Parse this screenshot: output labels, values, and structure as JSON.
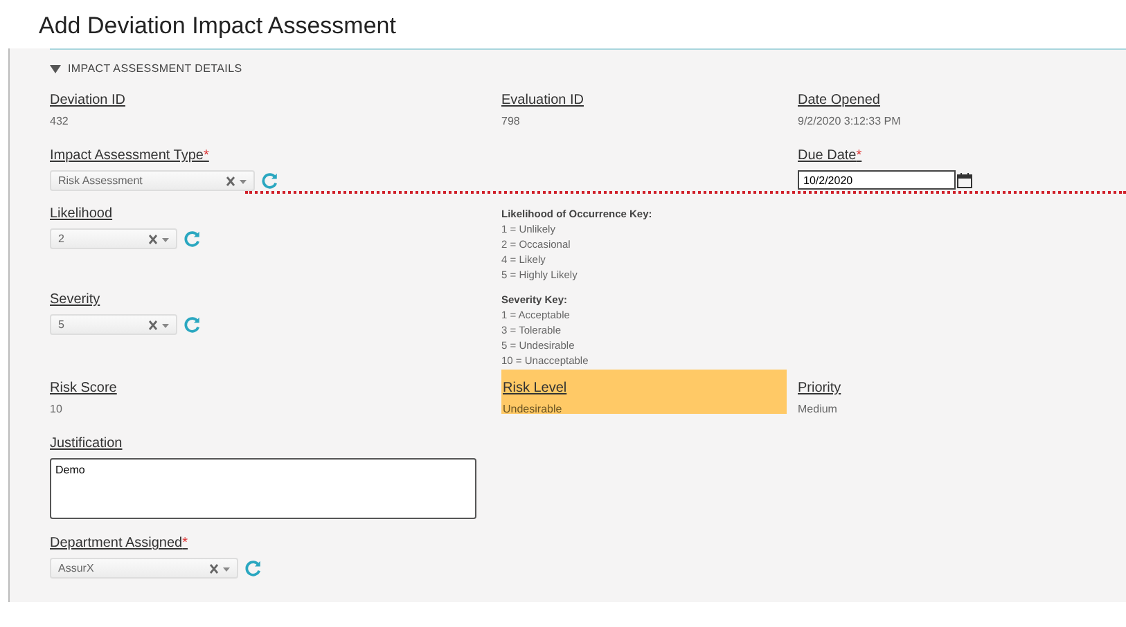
{
  "title": "Add Deviation Impact Assessment",
  "section": {
    "label": "IMPACT ASSESSMENT DETAILS",
    "expanded": true
  },
  "deviation_id": {
    "label": "Deviation ID",
    "value": "432"
  },
  "evaluation_id": {
    "label": "Evaluation ID",
    "value": "798"
  },
  "date_opened": {
    "label": "Date Opened",
    "value": "9/2/2020 3:12:33 PM"
  },
  "impact_assessment_type": {
    "label": "Impact Assessment Type",
    "required_mark": "*",
    "value": "Risk Assessment"
  },
  "due_date": {
    "label": "Due Date",
    "required_mark": "*",
    "value": "10/2/2020"
  },
  "likelihood": {
    "label": "Likelihood",
    "value": "2"
  },
  "likelihood_key": {
    "title": "Likelihood of Occurrence Key:",
    "lines": [
      "1 = Unlikely",
      "2 = Occasional",
      "4 = Likely",
      "5 = Highly Likely"
    ]
  },
  "severity": {
    "label": "Severity",
    "value": "5"
  },
  "severity_key": {
    "title": "Severity Key:",
    "lines": [
      "1 = Acceptable",
      "3 = Tolerable",
      "5 = Undesirable",
      "10 = Unacceptable"
    ]
  },
  "risk_score": {
    "label": "Risk Score",
    "value": "10"
  },
  "risk_level": {
    "label": "Risk Level",
    "value": "Undesirable",
    "color": "#ffc966"
  },
  "priority": {
    "label": "Priority",
    "value": "Medium"
  },
  "justification": {
    "label": "Justification",
    "value": "Demo"
  },
  "department_assigned": {
    "label": "Department Assigned",
    "required_mark": "*",
    "value": "AssurX"
  }
}
